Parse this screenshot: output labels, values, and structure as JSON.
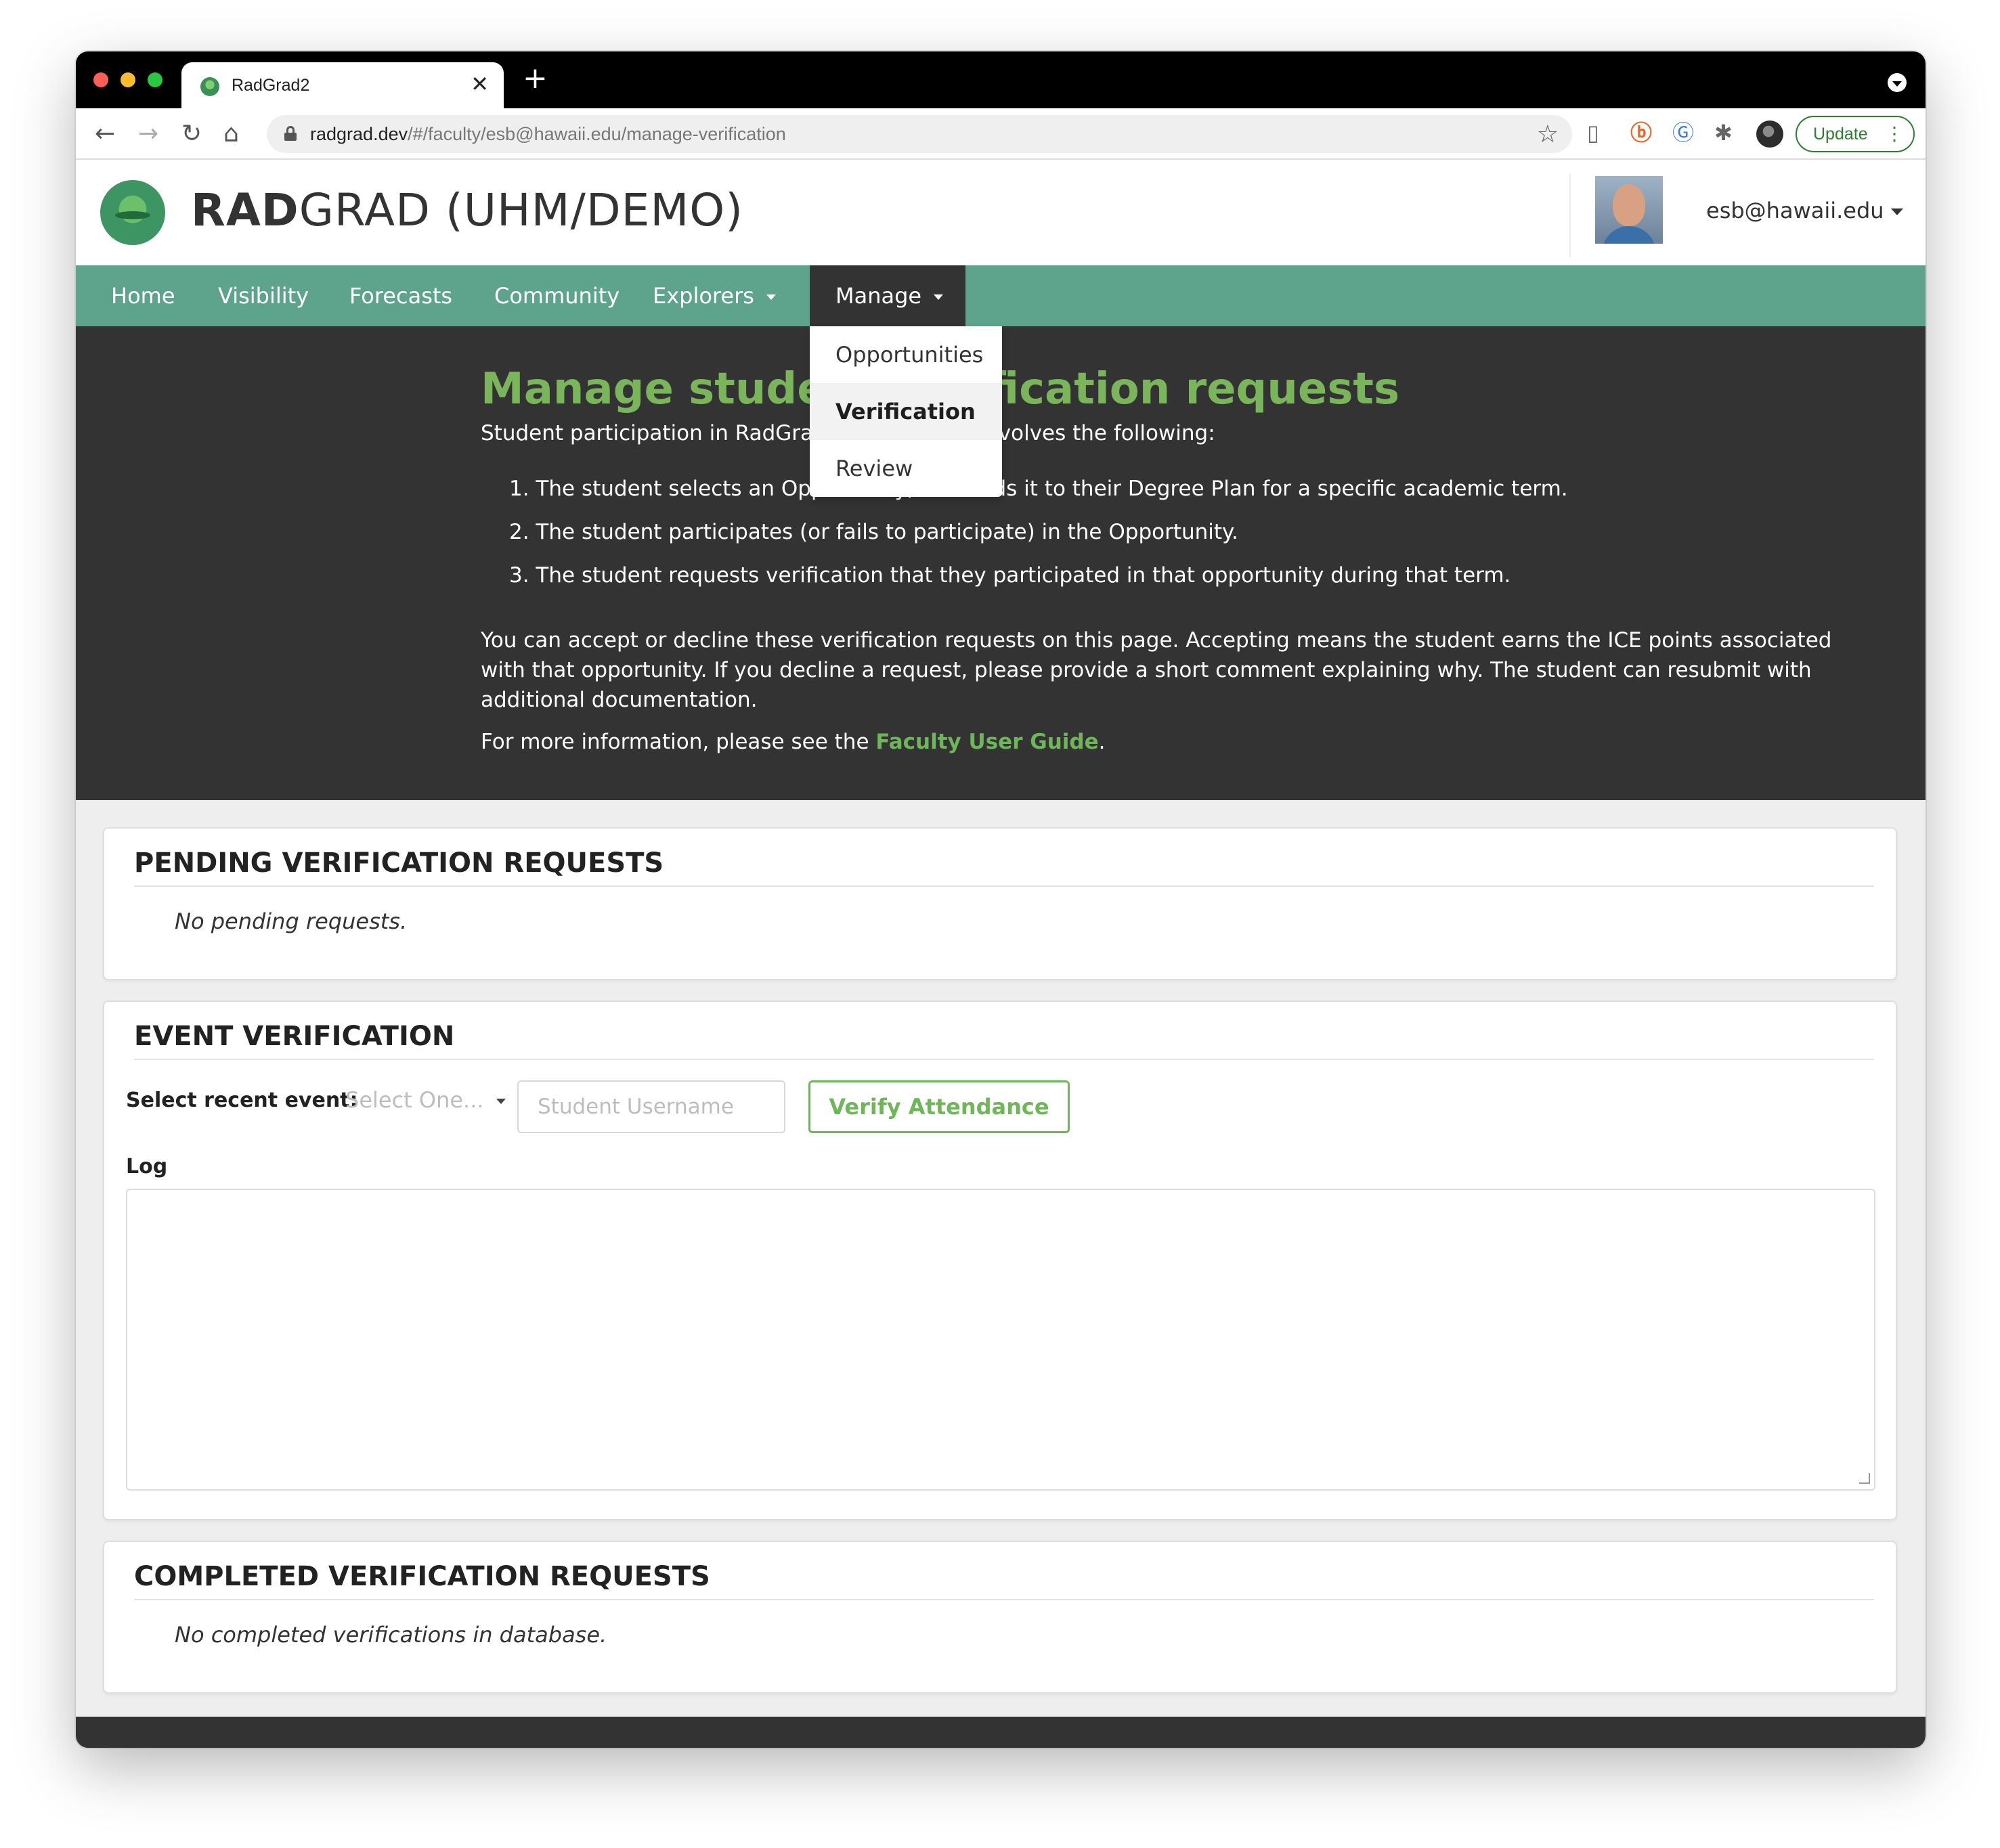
{
  "browser": {
    "tab_title": "RadGrad2",
    "tab_close": "✕",
    "new_tab": "+",
    "url_host": "radgrad.dev",
    "url_path": "/#/faculty/esb@hawaii.edu/manage-verification",
    "update_label": "Update",
    "update_menu": "⋮"
  },
  "header": {
    "title_bold": "RAD",
    "title_rest": "GRAD (UHM/DEMO)",
    "user_email": "esb@hawaii.edu"
  },
  "nav": {
    "home": "Home",
    "visibility": "Visibility",
    "forecasts": "Forecasts",
    "community": "Community",
    "explorers": "Explorers",
    "manage": "Manage"
  },
  "manage_menu": {
    "opportunities": "Opportunities",
    "verification": "Verification",
    "review": "Review"
  },
  "hero": {
    "title": "Manage student verification requests",
    "intro": "Student participation in RadGrad opportunities involves the following:",
    "steps": [
      "1. The student selects an Opportunity, and adds it to their Degree Plan for a specific academic term.",
      "2. The student participates (or fails to participate) in the Opportunity.",
      "3. The student requests verification that they participated in that opportunity during that term."
    ],
    "paragraph": "You can accept or decline these verification requests on this page. Accepting means the student earns the ICE points associated with that opportunity. If you decline a request, please provide a short comment explaining why. The student can resubmit with additional documentation.",
    "more_prefix": "For more information, please see the ",
    "guide_link": "Faculty User Guide",
    "more_suffix": "."
  },
  "pending": {
    "header": "PENDING VERIFICATION REQUESTS",
    "empty": "No pending requests."
  },
  "event": {
    "header": "EVENT VERIFICATION",
    "select_label": "Select recent event:",
    "select_placeholder": "Select One...",
    "username_placeholder": "Student Username",
    "verify_label": "Verify Attendance",
    "log_label": "Log",
    "log_value": ""
  },
  "completed": {
    "header": "COMPLETED VERIFICATION REQUESTS",
    "empty": "No completed verifications in database."
  },
  "colors": {
    "nav_green": "#5ea48d",
    "accent_green": "#6fb55a",
    "dark": "#333333"
  },
  "icons": [
    "back-icon",
    "forward-icon",
    "reload-icon",
    "home-icon",
    "lock-icon",
    "star-icon",
    "chevron-down-icon",
    "close-icon",
    "puzzle-icon"
  ]
}
